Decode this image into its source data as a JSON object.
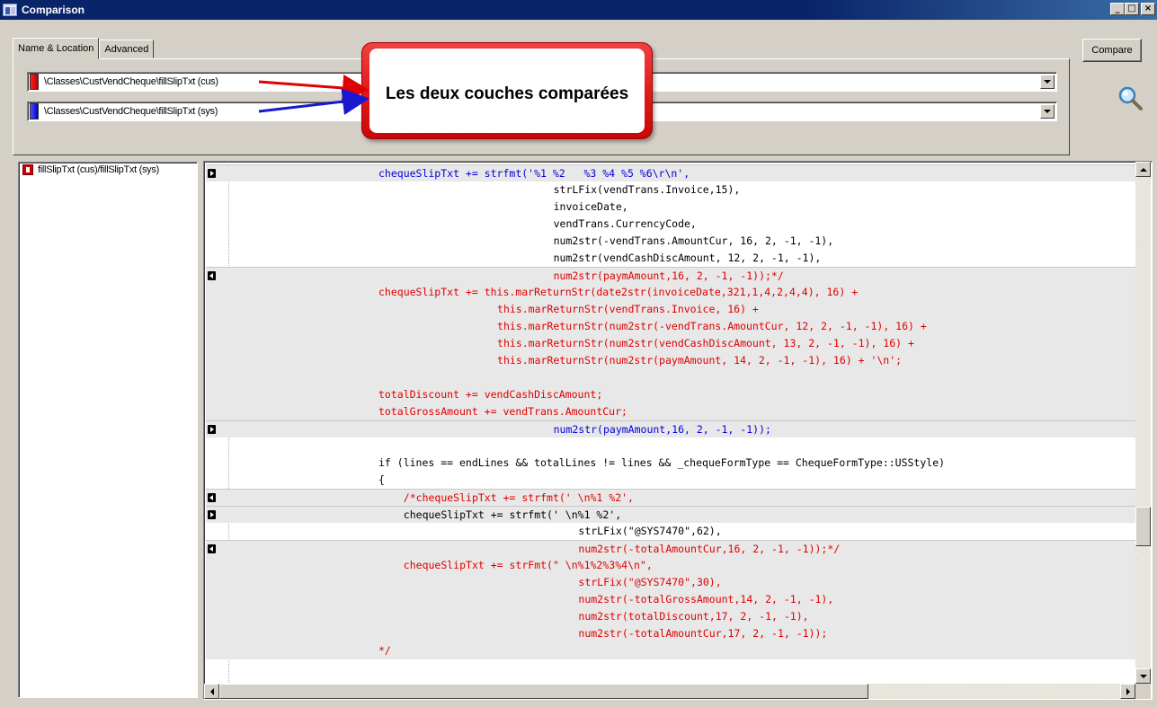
{
  "window": {
    "title": "Comparison",
    "controls": {
      "minimize": "_",
      "maximize": "□",
      "close": "×"
    }
  },
  "tabs": [
    {
      "label": "Name & Location",
      "active": true
    },
    {
      "label": "Advanced",
      "active": false
    }
  ],
  "compare_button": "Compare",
  "layers": [
    {
      "path": "\\Classes\\CustVendCheque\\fillSlipTxt (cus)",
      "color": "#e00000"
    },
    {
      "path": "\\Classes\\CustVendCheque\\fillSlipTxt (sys)",
      "color": "#2020e0"
    }
  ],
  "callout": {
    "text": "Les deux couches comparées"
  },
  "tree": {
    "item": "fillSlipTxt (cus)/fillSlipTxt (sys)"
  },
  "code_lines": [
    {
      "text": "chequeSlipTxt += strfmt('%1 %2   %3 %4 %5 %6\\r\\n',",
      "color": "blue",
      "indent": 0,
      "mark": "right",
      "shade": true
    },
    {
      "text": "strLFix(vendTrans.Invoice,15),",
      "color": "black",
      "indent": 28,
      "mark": "",
      "shade": false
    },
    {
      "text": "invoiceDate,",
      "color": "black",
      "indent": 28,
      "mark": "",
      "shade": false
    },
    {
      "text": "vendTrans.CurrencyCode,",
      "color": "black",
      "indent": 28,
      "mark": "",
      "shade": false
    },
    {
      "text": "num2str(-vendTrans.AmountCur, 16, 2, -1, -1),",
      "color": "black",
      "indent": 28,
      "mark": "",
      "shade": false
    },
    {
      "text": "num2str(vendCashDiscAmount, 12, 2, -1, -1),",
      "color": "black",
      "indent": 28,
      "mark": "",
      "shade": false
    },
    {
      "text": "num2str(paymAmount,16, 2, -1, -1));*/",
      "color": "red",
      "indent": 28,
      "mark": "left",
      "shade": true
    },
    {
      "text": "chequeSlipTxt += this.marReturnStr(date2str(invoiceDate,321,1,4,2,4,4), 16) +",
      "color": "red",
      "indent": 0,
      "mark": "",
      "shade": true
    },
    {
      "text": "this.marReturnStr(vendTrans.Invoice, 16) +",
      "color": "red",
      "indent": 19,
      "mark": "",
      "shade": true
    },
    {
      "text": "this.marReturnStr(num2str(-vendTrans.AmountCur, 12, 2, -1, -1), 16) +",
      "color": "red",
      "indent": 19,
      "mark": "",
      "shade": true
    },
    {
      "text": "this.marReturnStr(num2str(vendCashDiscAmount, 13, 2, -1, -1), 16) +",
      "color": "red",
      "indent": 19,
      "mark": "",
      "shade": true
    },
    {
      "text": "this.marReturnStr(num2str(paymAmount, 14, 2, -1, -1), 16) + '\\n';",
      "color": "red",
      "indent": 19,
      "mark": "",
      "shade": true
    },
    {
      "text": "",
      "color": "red",
      "indent": 0,
      "mark": "",
      "shade": true
    },
    {
      "text": "totalDiscount += vendCashDiscAmount;",
      "color": "red",
      "indent": 0,
      "mark": "",
      "shade": true
    },
    {
      "text": "totalGrossAmount += vendTrans.AmountCur;",
      "color": "red",
      "indent": 0,
      "mark": "",
      "shade": true
    },
    {
      "text": "num2str(paymAmount,16, 2, -1, -1));",
      "color": "blue",
      "indent": 28,
      "mark": "right",
      "shade": true
    },
    {
      "text": "",
      "color": "black",
      "indent": 0,
      "mark": "",
      "shade": false
    },
    {
      "text": "if (lines == endLines && totalLines != lines && _chequeFormType == ChequeFormType::USStyle)",
      "color": "black",
      "indent": 0,
      "mark": "",
      "shade": false
    },
    {
      "text": "{",
      "color": "black",
      "indent": 0,
      "mark": "",
      "shade": false
    },
    {
      "text": "/*chequeSlipTxt += strfmt(' \\n%1 %2',",
      "color": "red",
      "indent": 4,
      "mark": "left",
      "shade": true
    },
    {
      "text": "chequeSlipTxt += strfmt(' \\n%1 %2',",
      "color": "black",
      "indent": 4,
      "mark": "right",
      "shade": true
    },
    {
      "text": "strLFix(\"@SYS7470\",62),",
      "color": "black",
      "indent": 32,
      "mark": "",
      "shade": false
    },
    {
      "text": "num2str(-totalAmountCur,16, 2, -1, -1));*/",
      "color": "red",
      "indent": 32,
      "mark": "left",
      "shade": true
    },
    {
      "text": "chequeSlipTxt += strFmt(\" \\n%1%2%3%4\\n\",",
      "color": "red",
      "indent": 4,
      "mark": "",
      "shade": true
    },
    {
      "text": "strLFix(\"@SYS7470\",30),",
      "color": "red",
      "indent": 32,
      "mark": "",
      "shade": true
    },
    {
      "text": "num2str(-totalGrossAmount,14, 2, -1, -1),",
      "color": "red",
      "indent": 32,
      "mark": "",
      "shade": true
    },
    {
      "text": "num2str(totalDiscount,17, 2, -1, -1),",
      "color": "red",
      "indent": 32,
      "mark": "",
      "shade": true
    },
    {
      "text": "num2str(-totalAmountCur,17, 2, -1, -1));",
      "color": "red",
      "indent": 32,
      "mark": "",
      "shade": true
    },
    {
      "text": "*/",
      "color": "red",
      "indent": 0,
      "mark": "",
      "shade": true
    }
  ]
}
